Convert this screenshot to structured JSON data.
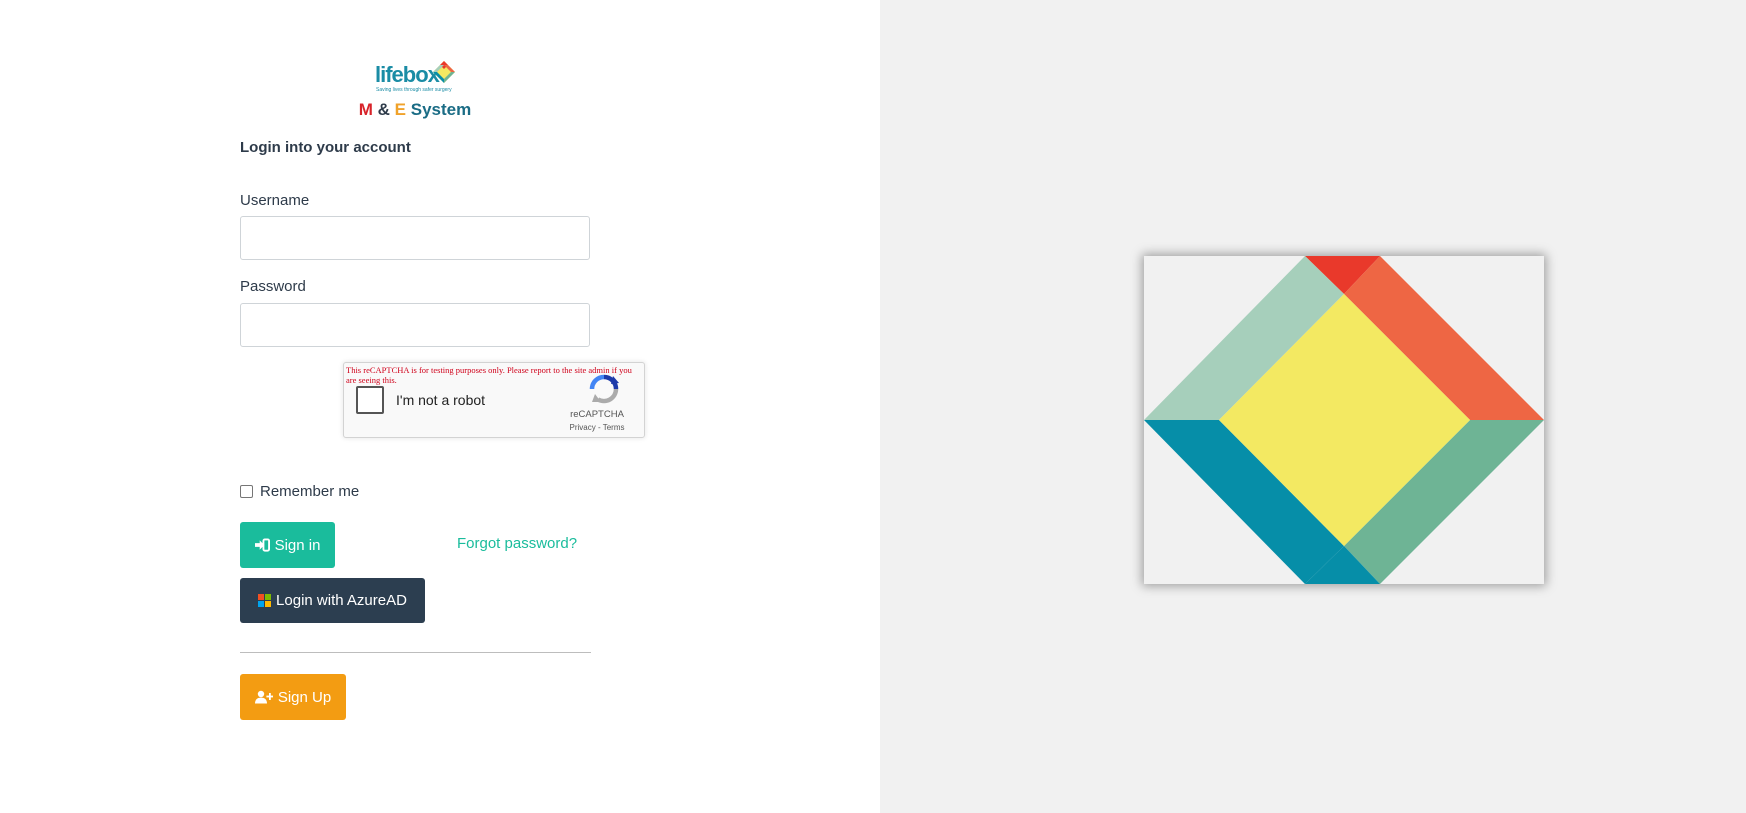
{
  "brand": {
    "logo_text": "lifebox",
    "logo_tagline": "Saving lives through safer surgery",
    "system_title": {
      "m": "M",
      "amp": "&",
      "e": "E",
      "system": "System"
    }
  },
  "login": {
    "heading": "Login into your account",
    "username_label": "Username",
    "username_value": "",
    "password_label": "Password",
    "password_value": ""
  },
  "captcha": {
    "warning": "This reCAPTCHA is for testing purposes only. Please report to the site admin if you are seeing this.",
    "checkbox_label": "I'm not a robot",
    "brand": "reCAPTCHA",
    "links": "Privacy - Terms"
  },
  "remember": {
    "label": "Remember me",
    "checked": false
  },
  "actions": {
    "signin_label": "Sign in",
    "forgot_label": "Forgot password?",
    "azure_label": "Login with AzureAD",
    "signup_label": "Sign Up"
  },
  "colors": {
    "signin": "#1abc9c",
    "azure": "#2c3e50",
    "signup": "#f39c12",
    "right_panel": "#f1f1f1",
    "hero_red": "#e9392b",
    "hero_orange": "#ee6644",
    "hero_mint": "#a6cfbb",
    "hero_yellow": "#f3e962",
    "hero_teal": "#068ea8",
    "hero_green": "#6eb495"
  },
  "icons": {
    "signin": "sign-in-icon",
    "azure": "microsoft-logo-icon",
    "signup": "user-plus-icon",
    "captcha": "recaptcha-logo-icon"
  }
}
